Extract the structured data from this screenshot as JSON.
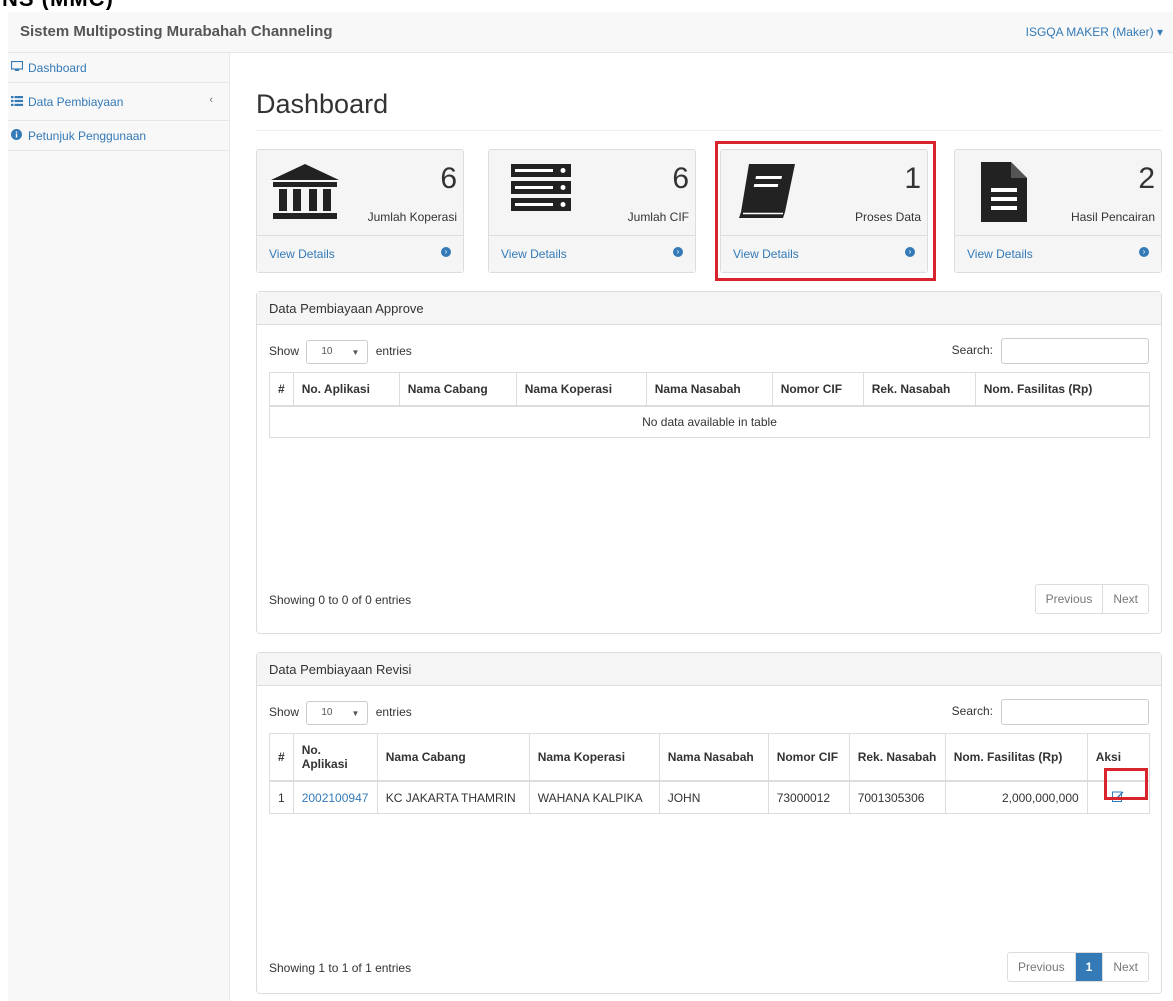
{
  "window_top_text": "NS (MMC)",
  "navbar": {
    "brand": "Sistem Multiposting Murabahah Channeling",
    "user": "ISGQA MAKER (Maker) ▾"
  },
  "sidebar": {
    "items": [
      {
        "label": "Dashboard",
        "icon": "desktop-icon"
      },
      {
        "label": "Data Pembiayaan",
        "icon": "list-icon",
        "chevron": "‹"
      },
      {
        "label": "Petunjuk Penggunaan",
        "icon": "info-circle-icon"
      }
    ]
  },
  "page_title": "Dashboard",
  "tiles": [
    {
      "number": "6",
      "label": "Jumlah Koperasi",
      "link": "View Details",
      "icon": "bank-icon"
    },
    {
      "number": "6",
      "label": "Jumlah CIF",
      "link": "View Details",
      "icon": "server-icon"
    },
    {
      "number": "1",
      "label": "Proses Data",
      "link": "View Details",
      "icon": "book-icon"
    },
    {
      "number": "2",
      "label": "Hasil Pencairan",
      "link": "View Details",
      "icon": "file-icon"
    }
  ],
  "panel_approve": {
    "title": "Data Pembiayaan Approve",
    "show": "Show",
    "entries_value": "10",
    "entries": "entries",
    "search": "Search:",
    "columns": [
      "#",
      "No. Aplikasi",
      "Nama Cabang",
      "Nama Koperasi",
      "Nama Nasabah",
      "Nomor CIF",
      "Rek. Nasabah",
      "Nom. Fasilitas (Rp)"
    ],
    "empty": "No data available in table",
    "info": "Showing 0 to 0 of 0 entries",
    "prev": "Previous",
    "next": "Next"
  },
  "panel_revisi": {
    "title": "Data Pembiayaan Revisi",
    "show": "Show",
    "entries_value": "10",
    "entries": "entries",
    "search": "Search:",
    "columns": [
      "#",
      "No. Aplikasi",
      "Nama Cabang",
      "Nama Koperasi",
      "Nama Nasabah",
      "Nomor CIF",
      "Rek. Nasabah",
      "Nom. Fasilitas (Rp)",
      "Aksi"
    ],
    "rows": [
      {
        "no": "1",
        "aplikasi": "2002100947",
        "cabang": "KC JAKARTA THAMRIN",
        "koperasi": "WAHANA KALPIKA",
        "nasabah": "JOHN",
        "cif": "73000012",
        "rek": "7001305306",
        "fasilitas": "2,000,000,000"
      }
    ],
    "info": "Showing 1 to 1 of 1 entries",
    "prev": "Previous",
    "page": "1",
    "next": "Next"
  },
  "colors": {
    "link": "#337ab7",
    "highlight": "#d9232d"
  }
}
